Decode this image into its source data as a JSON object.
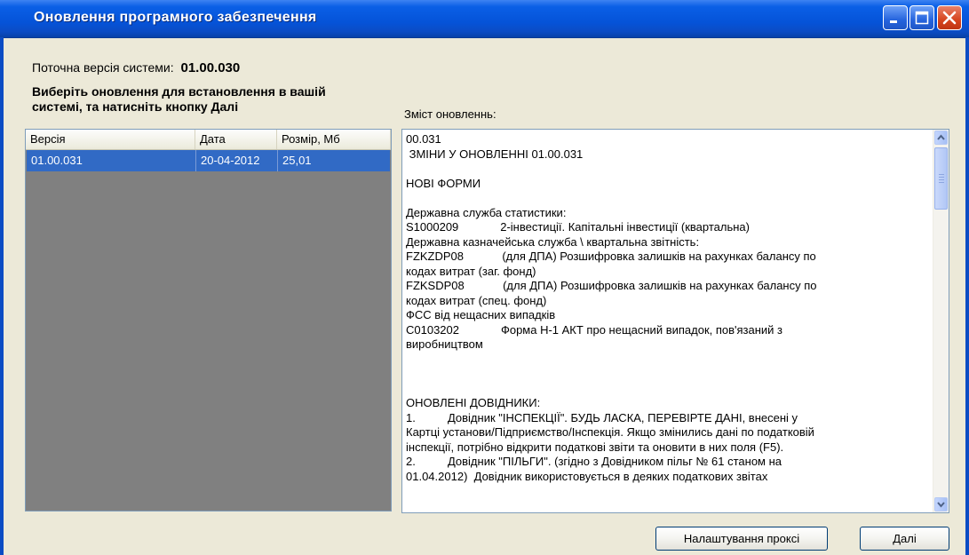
{
  "window": {
    "title": "Оновлення програмного забезпечення"
  },
  "version_label": "Поточна версія системи:",
  "version_value": "01.00.030",
  "instruction_line1": "Виберіть оновлення для встановлення в вашій",
  "instruction_line2": "системі, та натисніть кнопку Далі",
  "changes_label": "Зміст оновленнь:",
  "updates_table": {
    "columns": [
      "Версія",
      "Дата",
      "Розмір, Мб"
    ],
    "rows": [
      {
        "version": "01.00.031",
        "date": "20-04-2012",
        "size": "25,01",
        "selected": true
      }
    ]
  },
  "changes_text": "00.031\n ЗМІНИ У ОНОВЛЕННІ 01.00.031\n\nНОВІ ФОРМИ\n\nДержавна служба статистики:\nS1000209             2-інвестиції. Капітальні інвестиції (квартальна)\nДержавна казначейська служба \\ квартальна звітність:\nFZKZDP08            (для ДПА) Розшифровка залишків на рахунках балансу по\nкодах витрат (заг. фонд)\nFZKSDP08            (для ДПА) Розшифровка залишків на рахунках балансу по\nкодах витрат (спец. фонд)\nФСС від нещасних випадків\nC0103202             Форма Н-1 АКТ про нещасний випадок, пов'язаний з\nвиробництвом\n\n\n\nОНОВЛЕНІ ДОВІДНИКИ:\n1.          Довідник \"ІНСПЕКЦІЇ\". БУДЬ ЛАСКА, ПЕРЕВІРТЕ ДАНІ, внесені у\nКартці установи/Підприємство/Інспекція. Якщо змінились дані по податковій\nінспекції, потрібно відкрити податкові звіти та оновити в них поля (F5).\n2.          Довідник \"ПІЛЬГИ\". (згідно з Довідником пільг № 61 станом на\n01.04.2012)  Довідник використовується в деяких податкових звітах",
  "buttons": {
    "proxy": "Налаштування проксі",
    "next": "Далі"
  },
  "colors": {
    "titlebar": "#0553d8",
    "selection": "#316ac5",
    "dialog_bg": "#ece9d8",
    "list_bg": "#808080"
  },
  "icons": [
    "minimize-icon",
    "maximize-icon",
    "close-icon",
    "scroll-up-icon",
    "scroll-down-icon"
  ]
}
